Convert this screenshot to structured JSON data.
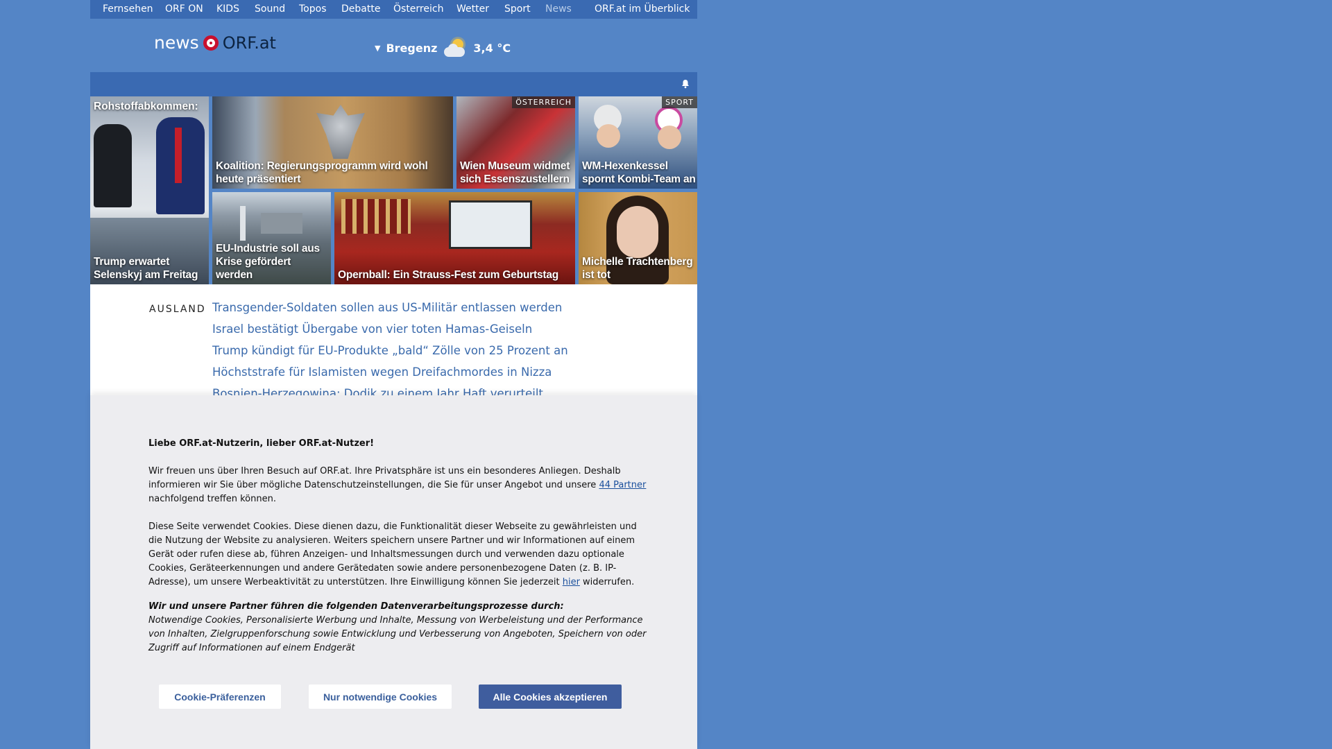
{
  "nav": {
    "items": [
      "Fernsehen",
      "ORF ON",
      "KIDS",
      "Sound",
      "Topos",
      "Debatte",
      "Österreich",
      "Wetter",
      "Sport",
      "News",
      "ORF.at im Überblick"
    ]
  },
  "header": {
    "logo_news": "news",
    "logo_orf": "ORF.at",
    "weather_city": "Bregenz",
    "weather_temp": "3,4 °C",
    "weather_icon": "partly-cloudy-icon"
  },
  "tiles": [
    {
      "caption": "Rohstoffabkommen:",
      "caption2": "Trump erwartet Selenskyj am Freitag"
    },
    {
      "caption": "Koalition: Regierungsprogramm wird wohl heute präsentiert"
    },
    {
      "caption": "Wien Museum widmet sich Essenszustellern",
      "badge": "ÖSTERREICH"
    },
    {
      "caption": "WM-Hexenkessel spornt Kombi-Team an",
      "badge": "SPORT"
    },
    {
      "caption": "EU-Industrie soll aus Krise gefördert werden"
    },
    {
      "caption": "Opernball: Ein Strauss-Fest zum Geburtstag"
    },
    {
      "caption": "Michelle Trachtenberg ist tot"
    }
  ],
  "news": {
    "section": "AUSLAND",
    "headlines": [
      "Transgender-Soldaten sollen aus US-Militär entlassen werden",
      "Israel bestätigt Übergabe von vier toten Hamas-Geiseln",
      "Trump kündigt für EU-Produkte „bald“ Zölle von 25 Prozent an",
      "Höchststrafe für Islamisten wegen Dreifachmordes in Nizza",
      "Bosnien-Herzegowina: Dodik zu einem Jahr Haft verurteilt"
    ]
  },
  "cookie": {
    "title": "Liebe ORF.at-Nutzerin, lieber ORF.at-Nutzer!",
    "p1_a": "Wir freuen uns über Ihren Besuch auf ORF.at. Ihre Privatsphäre ist uns ein besonderes Anliegen. Deshalb informieren wir Sie über mögliche Datenschutzeinstellungen, die Sie für unser Angebot und unsere ",
    "p1_link": "44 Partner",
    "p1_b": " nachfolgend treffen können.",
    "p2_a": "Diese Seite verwendet Cookies. Diese dienen dazu, die Funktionalität dieser Webseite zu gewährleisten und die Nutzung der Website zu analysieren. Weiters speichern unsere Partner und wir Informationen auf einem Gerät oder rufen diese ab, führen Anzeigen- und Inhaltsmessungen durch und verwenden dazu optionale Cookies, Geräteerkennungen und andere Gerätedaten sowie andere personenbezogene Daten (z. B. IP-Adresse), um unsere Werbeaktivität zu unterstützen. Ihre Einwilligung können Sie jederzeit ",
    "p2_link": "hier",
    "p2_b": " widerrufen.",
    "p3_title": "Wir und unsere Partner führen die folgenden Datenverarbeitungsprozesse durch:",
    "p3_body": "Notwendige Cookies, Personalisierte Werbung und Inhalte, Messung von Werbeleistung und der Performance von Inhalten, Zielgruppenforschung sowie Entwicklung und Verbesserung von Angeboten, Speichern von oder Zugriff auf Informationen auf einem Endgerät",
    "btn_prefs": "Cookie-Präferenzen",
    "btn_necessary": "Nur notwendige Cookies",
    "btn_accept": "Alle Cookies akzeptieren"
  }
}
